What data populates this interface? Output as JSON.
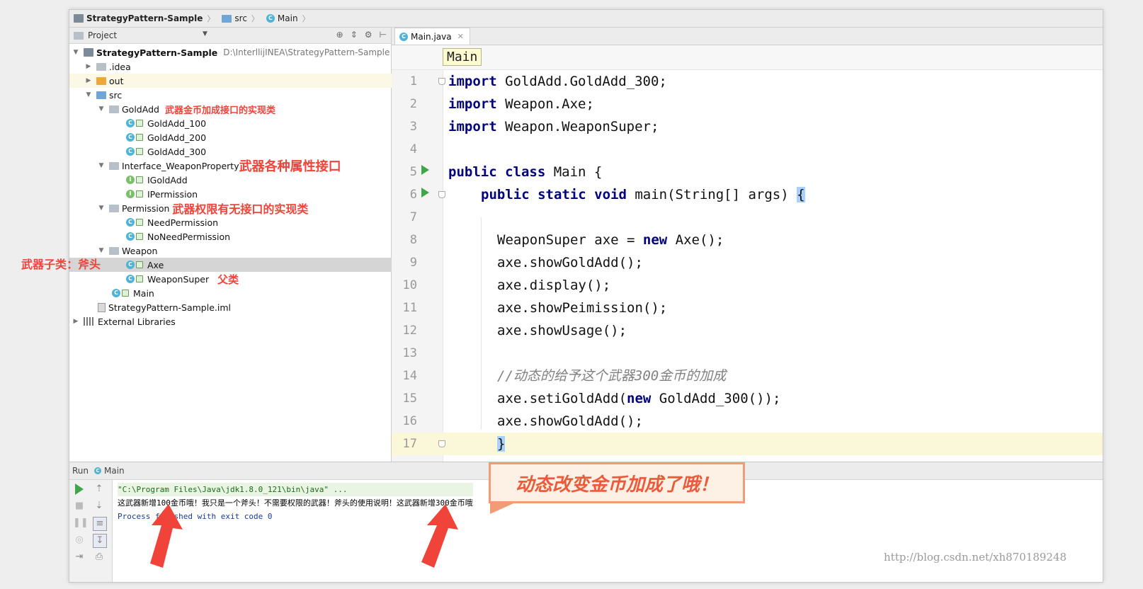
{
  "breadcrumb": {
    "project": "StrategyPattern-Sample",
    "src": "src",
    "main": "Main"
  },
  "project_panel": {
    "title": "Project",
    "tree": [
      {
        "label": "StrategyPattern-Sample",
        "path": "D:\\InterllijINEA\\StrategyPattern-Sample"
      },
      {
        "label": ".idea"
      },
      {
        "label": "out"
      },
      {
        "label": "src"
      },
      {
        "label": "GoldAdd",
        "note": "武器金币加成接口的实现类"
      },
      {
        "label": "GoldAdd_100"
      },
      {
        "label": "GoldAdd_200"
      },
      {
        "label": "GoldAdd_300"
      },
      {
        "label": "Interface_WeaponProperty",
        "note": "武器各种属性接口"
      },
      {
        "label": "IGoldAdd"
      },
      {
        "label": "IPermission"
      },
      {
        "label": "Permission",
        "note": "武器权限有无接口的实现类"
      },
      {
        "label": "NeedPermission"
      },
      {
        "label": "NoNeedPermission"
      },
      {
        "label": "Weapon"
      },
      {
        "label": "Axe"
      },
      {
        "label": "WeaponSuper",
        "note": "父类"
      },
      {
        "label": "Main"
      },
      {
        "label": "StrategyPattern-Sample.iml"
      },
      {
        "label": "External Libraries"
      }
    ],
    "side_note": "武器子类：斧头"
  },
  "editor": {
    "tab": "Main.java",
    "crumb": "Main",
    "lines": [
      {
        "n": "1",
        "kw": "import",
        "rest": " GoldAdd.GoldAdd_300;"
      },
      {
        "n": "2",
        "kw": "import",
        "rest": " Weapon.Axe;"
      },
      {
        "n": "3",
        "kw": "import",
        "rest": " Weapon.WeaponSuper;"
      },
      {
        "n": "4"
      },
      {
        "n": "5",
        "kw": "public class",
        "rest": " Main {"
      },
      {
        "n": "6",
        "kw": "public static void",
        "rest": " main(String[] args) ",
        "brace": "{"
      },
      {
        "n": "7"
      },
      {
        "n": "8",
        "pre": "WeaponSuper axe = ",
        "kw": "new",
        "rest": " Axe();"
      },
      {
        "n": "9",
        "rest": "axe.showGoldAdd();"
      },
      {
        "n": "10",
        "rest": "axe.display();"
      },
      {
        "n": "11",
        "rest": "axe.showPeimission();"
      },
      {
        "n": "12",
        "rest": "axe.showUsage();"
      },
      {
        "n": "13"
      },
      {
        "n": "14",
        "comment": "//动态的给予这个武器300金币的加成"
      },
      {
        "n": "15",
        "pre": "axe.setiGoldAdd(",
        "kw": "new",
        "rest": " GoldAdd_300());"
      },
      {
        "n": "16",
        "rest": "axe.showGoldAdd();"
      },
      {
        "n": "17",
        "brace": "}"
      }
    ]
  },
  "run_panel": {
    "tab1": "Run",
    "tab2": "Main",
    "console": [
      "\"C:\\Program Files\\Java\\jdk1.8.0_121\\bin\\java\" ...",
      "这武器新增100金币哦！我只是一个斧头！不需要权限的武器！斧头的使用说明！这武器新增300金币哦",
      "Process finished with exit code 0"
    ]
  },
  "callout": "动态改变金币加成了哦！",
  "watermark": "http://blog.csdn.net/xh870189248"
}
